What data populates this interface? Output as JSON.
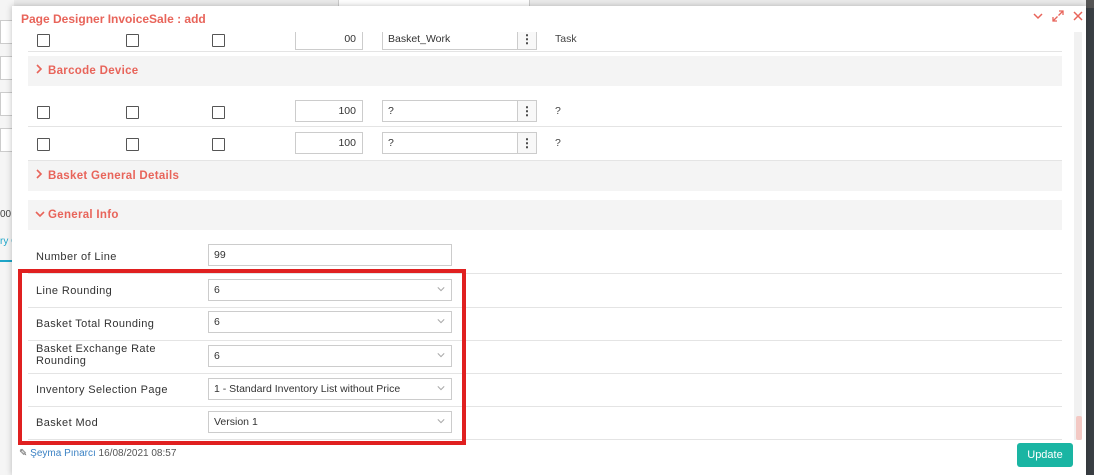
{
  "modal": {
    "title": "Page Designer InvoiceSale : add"
  },
  "background": {
    "left_value": "00",
    "left_tab": "ry C"
  },
  "top_partial_row": {
    "number": "00",
    "text": "Basket_Work",
    "description": "Task"
  },
  "sections": {
    "barcode_device": "Barcode Device",
    "basket_general_details": "Basket General Details",
    "general_info": "General Info"
  },
  "barcode_rows": [
    {
      "number": "100",
      "text": "?",
      "description": "?"
    },
    {
      "number": "100",
      "text": "?",
      "description": "?"
    }
  ],
  "general_info": {
    "number_of_line": {
      "label": "Number of Line",
      "value": "99"
    },
    "line_rounding": {
      "label": "Line Rounding",
      "value": "6"
    },
    "basket_total_rounding": {
      "label": "Basket Total Rounding",
      "value": "6"
    },
    "basket_exchange_rate_rounding": {
      "label": "Basket Exchange Rate Rounding",
      "value": "6"
    },
    "inventory_selection_page": {
      "label": "Inventory Selection Page",
      "value": "1 - Standard Inventory List without Price"
    },
    "basket_mod": {
      "label": "Basket Mod",
      "value": "Version 1"
    }
  },
  "footer": {
    "user": "Şeyma Pınarcı",
    "timestamp": "16/08/2021 08:57",
    "update_label": "Update"
  },
  "colors": {
    "accent": "#e8645a",
    "update": "#1ab5a3",
    "highlight": "#e02020"
  },
  "icons": {
    "minimize": "chevron-down-icon",
    "expand": "expand-icon",
    "close": "close-icon",
    "section_collapsed": "chevron-right-icon",
    "section_expanded": "chevron-down-icon",
    "more": "vertical-dots-icon",
    "edit": "pencil-icon"
  }
}
